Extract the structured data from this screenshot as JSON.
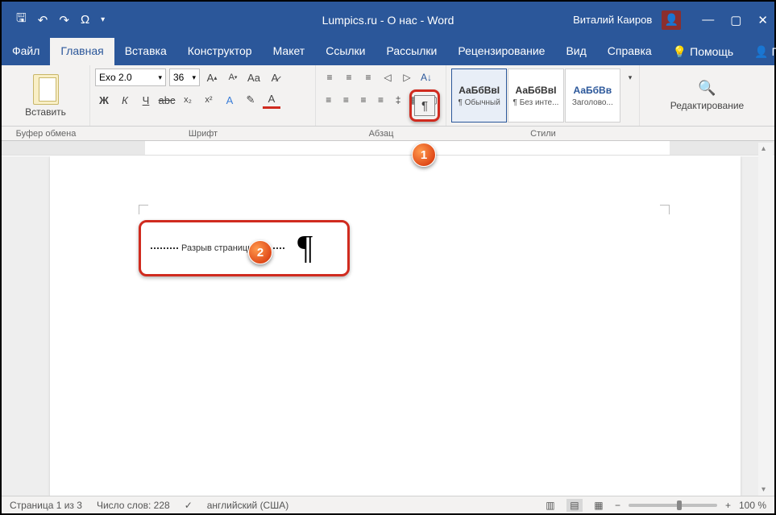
{
  "title": "Lumpics.ru - О нас  -  Word",
  "user": "Виталий Каиров",
  "menu": {
    "file": "Файл",
    "home": "Главная",
    "insert": "Вставка",
    "design": "Конструктор",
    "layout": "Макет",
    "references": "Ссылки",
    "mailings": "Рассылки",
    "review": "Рецензирование",
    "view": "Вид",
    "help": "Справка",
    "tellme": "Помощь",
    "share": "Поделиться"
  },
  "ribbon": {
    "paste": "Вставить",
    "font_name": "Exo 2.0",
    "font_size": "36",
    "clipboard_label": "Буфер обмена",
    "font_label": "Шрифт",
    "paragraph_label": "Абзац",
    "styles_label": "Стили",
    "editing_label": "Редактирование",
    "style1_preview": "АаБбВвІ",
    "style1_name": "¶ Обычный",
    "style2_preview": "АаБбВвІ",
    "style2_name": "¶ Без инте...",
    "style3_preview": "АаБбВв",
    "style3_name": "Заголово..."
  },
  "callouts": {
    "c1": "1",
    "c2": "2"
  },
  "page_break_text": "Разрыв страницы",
  "pilcrow": "¶",
  "status": {
    "page": "Страница 1 из 3",
    "words": "Число слов: 228",
    "lang": "английский (США)",
    "zoom": "100 %"
  }
}
